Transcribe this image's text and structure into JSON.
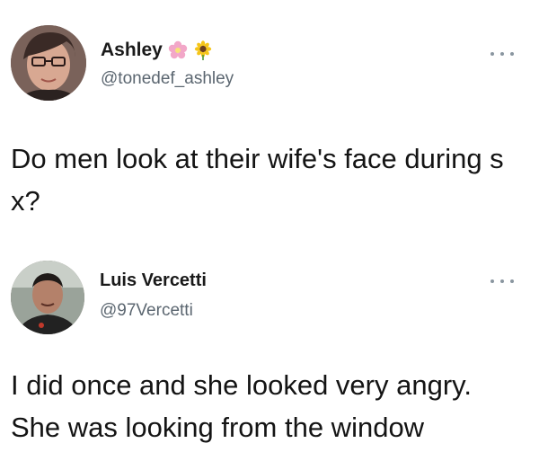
{
  "tweets": [
    {
      "display_name": "Ashley",
      "handle": "@tonedef_ashley",
      "emojis": [
        "flower-icon",
        "sunflower-icon"
      ],
      "text": "Do men look at their wife's face during s x?"
    },
    {
      "display_name": "Luis Vercetti",
      "handle": "@97Vercetti",
      "text": "I did once and she looked very angry. She was looking from the window"
    }
  ]
}
